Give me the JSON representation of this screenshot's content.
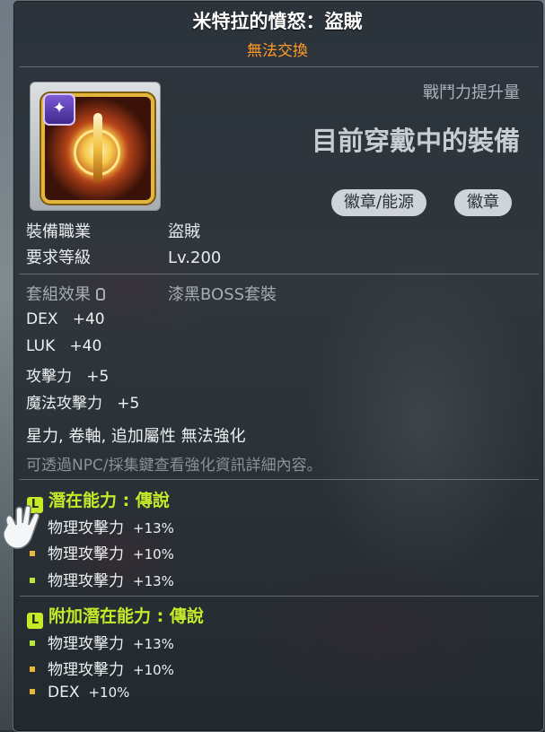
{
  "item": {
    "name": "米特拉的憤怒：盜賊",
    "tradeable": "無法交換"
  },
  "header": {
    "power_label": "戰鬥力提升量",
    "equipped_label": "目前穿戴中的裝備",
    "tags": [
      "徽章/能源",
      "徽章"
    ]
  },
  "requirements": [
    {
      "label": "裝備職業",
      "value": "盜賊"
    },
    {
      "label": "要求等級",
      "value": "Lv.200"
    }
  ],
  "set_effect": {
    "label": "套組效果",
    "value": "漆黑BOSS套裝"
  },
  "stats": [
    {
      "name": "DEX",
      "value": "+40"
    },
    {
      "name": "LUK",
      "value": "+40"
    },
    {
      "name": "攻擊力",
      "value": "+5"
    },
    {
      "name": "魔法攻擊力",
      "value": "+5"
    }
  ],
  "enhance": {
    "text": "星力, 卷軸, 追加屬性 無法強化",
    "hint": "可透過NPC/採集鍵查看強化資訊詳細內容。"
  },
  "potential": {
    "title": "潛在能力 : 傳說",
    "icon_letter": "L",
    "lines": [
      {
        "name": "物理攻擊力",
        "value": "+13%",
        "dot": "#b9e83a"
      },
      {
        "name": "物理攻擊力",
        "value": "+10%",
        "dot": "#e9b83a"
      },
      {
        "name": "物理攻擊力",
        "value": "+13%",
        "dot": "#b9e83a"
      }
    ]
  },
  "additional": {
    "title": "附加潛在能力 : 傳說",
    "icon_letter": "L",
    "lines": [
      {
        "name": "物理攻擊力",
        "value": "+13%",
        "dot": "#b9e83a"
      },
      {
        "name": "物理攻擊力",
        "value": "+10%",
        "dot": "#e9b83a"
      },
      {
        "name": "DEX",
        "value": "+10%",
        "dot": "#e9b83a"
      }
    ]
  },
  "colors": {
    "legendary": "#c6ea2a",
    "tradeable": "#ff9a2a"
  }
}
